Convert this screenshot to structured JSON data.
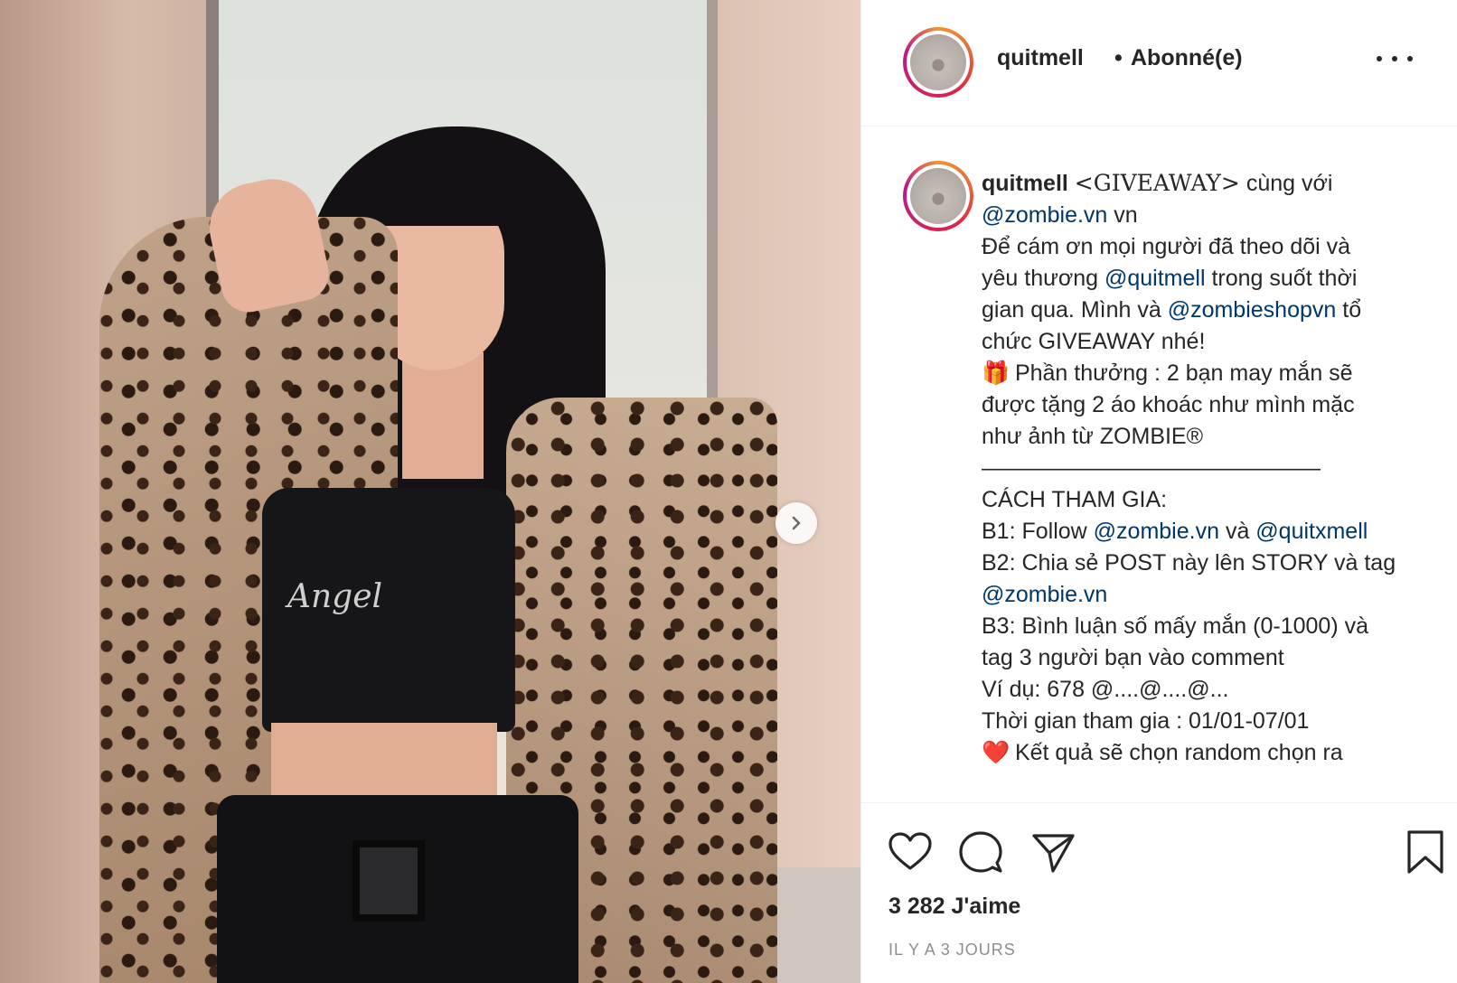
{
  "post": {
    "username": "quitmell",
    "separator": "•",
    "follow_status": "Abonné(e)",
    "photo_print": "Angel"
  },
  "caption": {
    "username": "quitmell",
    "lines": [
      {
        "parts": [
          {
            "t": "<GIVEAWAY>",
            "k": "serif"
          },
          {
            "t": " cùng với",
            "k": "text"
          }
        ]
      },
      {
        "parts": [
          {
            "t": "@zombie.vn",
            "k": "mention"
          },
          {
            "t": " vn",
            "k": "text"
          }
        ]
      },
      {
        "parts": [
          {
            "t": "Để cám ơn mọi người đã theo dõi và",
            "k": "text"
          }
        ]
      },
      {
        "parts": [
          {
            "t": "yêu thương ",
            "k": "text"
          },
          {
            "t": "@quitmell",
            "k": "mention"
          },
          {
            "t": " trong suốt thời",
            "k": "text"
          }
        ]
      },
      {
        "parts": [
          {
            "t": "gian qua. Mình và ",
            "k": "text"
          },
          {
            "t": "@zombieshopvn",
            "k": "mention"
          },
          {
            "t": " tổ",
            "k": "text"
          }
        ]
      },
      {
        "parts": [
          {
            "t": "chức GIVEAWAY nhé!",
            "k": "text"
          }
        ]
      },
      {
        "parts": [
          {
            "t": "🎁",
            "k": "emoji"
          },
          {
            "t": " Phần thưởng : 2 bạn may mắn sẽ",
            "k": "text"
          }
        ]
      },
      {
        "parts": [
          {
            "t": "được tặng 2 áo khoác như mình mặc",
            "k": "text"
          }
        ]
      },
      {
        "parts": [
          {
            "t": "như ảnh từ ZOMBIE®",
            "k": "text"
          }
        ]
      },
      {
        "parts": [
          {
            "t": "———————————————",
            "k": "text"
          }
        ]
      },
      {
        "parts": [
          {
            "t": "CÁCH THAM GIA:",
            "k": "text"
          }
        ]
      },
      {
        "parts": [
          {
            "t": "B1: Follow ",
            "k": "text"
          },
          {
            "t": "@zombie.vn",
            "k": "mention"
          },
          {
            "t": " và ",
            "k": "text"
          },
          {
            "t": "@quitxmell",
            "k": "mention"
          }
        ]
      },
      {
        "parts": [
          {
            "t": "B2: Chia sẻ POST này lên STORY và tag",
            "k": "text"
          }
        ]
      },
      {
        "parts": [
          {
            "t": "@zombie.vn",
            "k": "mention"
          }
        ]
      },
      {
        "parts": [
          {
            "t": "B3: Bình luận số mấy mắn (0-1000) và",
            "k": "text"
          }
        ]
      },
      {
        "parts": [
          {
            "t": "tag 3 người bạn vào comment",
            "k": "text"
          }
        ]
      },
      {
        "parts": [
          {
            "t": "Ví dụ: 678 @....@....@...",
            "k": "text"
          }
        ]
      },
      {
        "parts": [
          {
            "t": "Thời gian tham gia : 01/01-07/01",
            "k": "text"
          }
        ]
      },
      {
        "parts": [
          {
            "t": "❤️",
            "k": "emoji"
          },
          {
            "t": " Kết quả sẽ chọn random chọn ra",
            "k": "text"
          }
        ]
      }
    ]
  },
  "actions": {
    "likes": "3 282 J'aime",
    "timestamp": "IL Y A 3 JOURS"
  },
  "icons": {
    "next": "chevron-right-icon",
    "more": "more-dots-icon",
    "like": "heart-icon",
    "comment": "comment-bubble-icon",
    "share": "paper-plane-icon",
    "save": "bookmark-icon"
  },
  "colors": {
    "text": "#262626",
    "mention": "#00376b",
    "secondary": "#8e8e8e",
    "border": "#efefef"
  }
}
